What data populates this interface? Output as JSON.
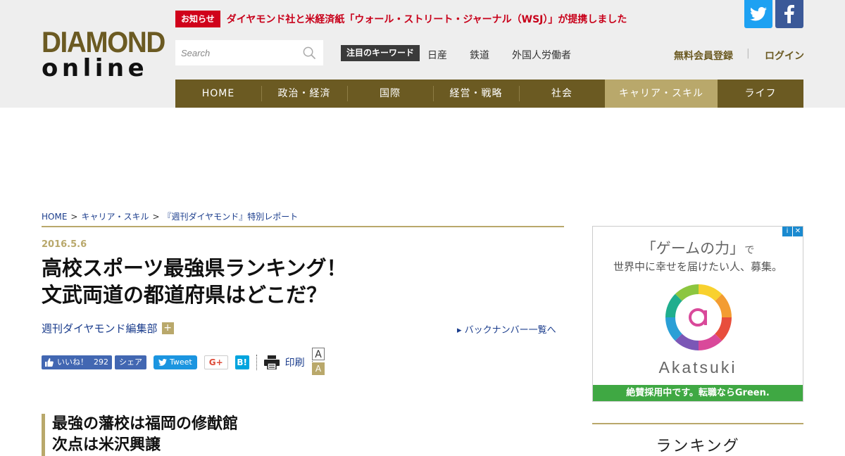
{
  "logo": {
    "line1": "DIAMOND",
    "line2": "online"
  },
  "notice": {
    "tag": "お知らせ",
    "text": "ダイヤモンド社と米経済紙「ウォール・ストリート・ジャーナル（WSJ）」が提携しました"
  },
  "social": {
    "twitter_icon": "twitter-icon",
    "facebook_icon": "facebook-icon"
  },
  "search": {
    "placeholder": "Search",
    "icon": "search-icon"
  },
  "keywords": {
    "label": "注目のキーワード",
    "items": [
      "日産",
      "鉄道",
      "外国人労働者"
    ]
  },
  "account": {
    "register": "無料会員登録",
    "separator": "|",
    "login": "ログイン"
  },
  "nav": {
    "items": [
      "HOME",
      "政治・経済",
      "国際",
      "経営・戦略",
      "社会",
      "キャリア・スキル",
      "ライフ"
    ],
    "active_index": 5
  },
  "breadcrumb": {
    "items": [
      "HOME",
      "キャリア・スキル",
      "『週刊ダイヤモンド』特別レポート"
    ],
    "separator": ">"
  },
  "article": {
    "date": "2016.5.6",
    "title_line1": "高校スポーツ最強県ランキング！",
    "title_line2": "文武両道の都道府県はどこだ？",
    "author": "週刊ダイヤモンド編集部",
    "author_plus": "+",
    "backnumber": "▸ バックナンバー一覧へ",
    "subhead_line1": "最強の藩校は福岡の修猷館",
    "subhead_line2": "次点は米沢興譲"
  },
  "share": {
    "like_label": "いいね！",
    "like_count": "292",
    "share_label": "シェア",
    "tweet_label": "Tweet",
    "gplus_label": "G+",
    "hatena_label": "B!",
    "print_label": "印刷",
    "font_large": "A",
    "font_small": "A"
  },
  "ad": {
    "headline": "「ゲームの力」",
    "headline_suffix": "で",
    "subline": "世界中に幸せを届けたい人、募集。",
    "brand": "Akatsuki",
    "footer": "絶賛採用中です。転職ならGreen.",
    "choices_info": "i",
    "choices_close": "✕"
  },
  "sidebar": {
    "ranking_title": "ランキング"
  },
  "colors": {
    "brand": "#6b5a22",
    "accent": "#b9a86b",
    "notice_red": "#d0021b",
    "link": "#1a3c8c"
  }
}
